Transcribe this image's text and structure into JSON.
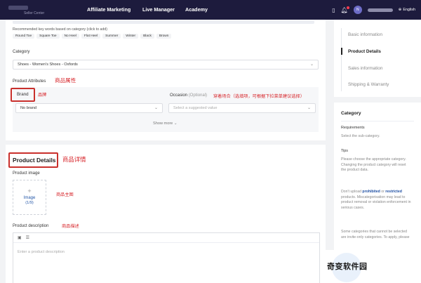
{
  "nav": {
    "links": [
      "Affiliate Marketing",
      "Live Manager",
      "Academy"
    ],
    "avatar_initial": "N",
    "language": "English"
  },
  "keywords": {
    "hint": "Recommended key words based on category (click to add)",
    "items": [
      "Round Toe",
      "Square Toe",
      "No Heel",
      "Flat Heel",
      "Summer",
      "Winter",
      "Black",
      "Brown"
    ]
  },
  "category": {
    "label": "Category",
    "value": "Shoes - Women's Shoes - Oxfords"
  },
  "attributes": {
    "label": "Product Attributes",
    "annotation": "商品属性",
    "brand_label": "Brand",
    "brand_annotation": "品牌",
    "brand_value": "No brand",
    "occasion_label": "Occasion",
    "occasion_optional": "(Optional)",
    "occasion_annotation": "穿着场合（选填项，可根据下拉菜单建议选择）",
    "occasion_placeholder": "Select a suggested value",
    "show_more": "Show more"
  },
  "details": {
    "title": "Product Details",
    "title_annotation": "商品详情",
    "image_label": "Product image",
    "image_text": "Image",
    "image_count": "(1/9)",
    "image_annotation": "商品主图",
    "desc_label": "Product description",
    "desc_annotation": "商品描述",
    "desc_placeholder": "Enter a product description"
  },
  "sidenav": {
    "items": [
      "Basic information",
      "Product Details",
      "Sales information",
      "Shipping & Warranty"
    ],
    "active_index": 1
  },
  "help": {
    "title": "Category",
    "req_title": "Requirements",
    "req_text": "Select the sub-category.",
    "tips_title": "Tips",
    "tip1": "Please choose the appropriate category. Changing the product category will reset the product data.",
    "tip2_a": "Don't upload ",
    "tip2_b1": "prohibited",
    "tip2_c": " or ",
    "tip2_b2": "restricted",
    "tip2_d": " products. Miscategorisation may lead to product removal or violation enforcement in serious cases.",
    "tip3": "Some categories that cannot be selected are invite-only categories. To apply, please"
  },
  "watermark": "奇变软件园",
  "colors": {
    "nav_bg": "#1d1b3d",
    "annotation_red": "#d7262b",
    "link_blue": "#2155a7"
  }
}
